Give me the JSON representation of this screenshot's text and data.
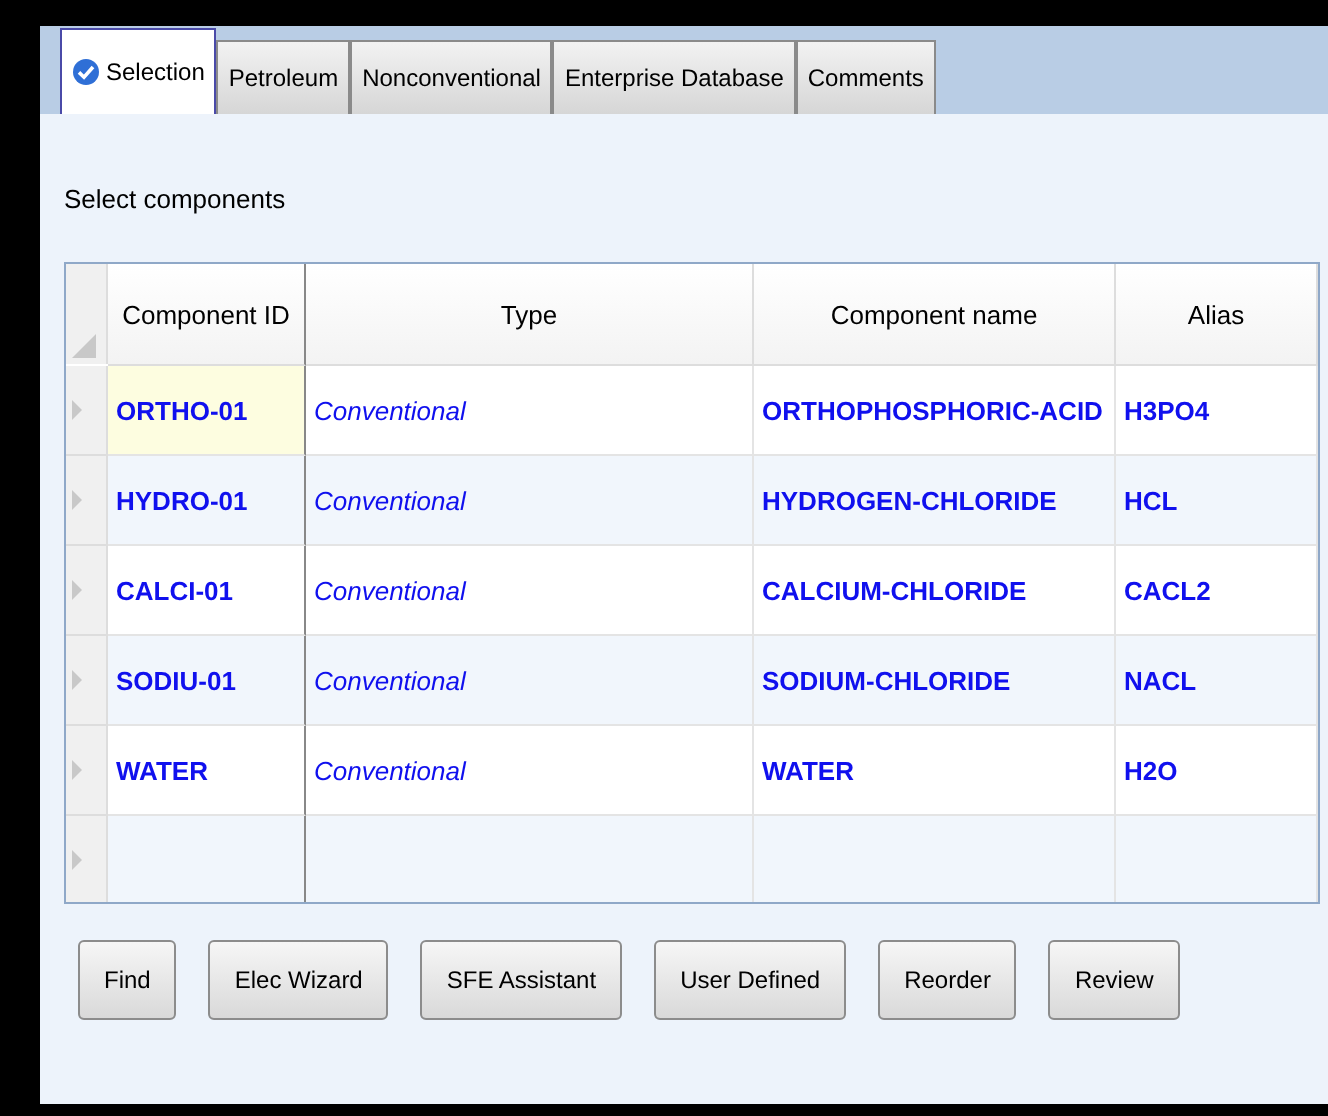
{
  "tabs": [
    {
      "label": "Selection",
      "selected": true
    },
    {
      "label": "Petroleum",
      "selected": false
    },
    {
      "label": "Nonconventional",
      "selected": false
    },
    {
      "label": "Enterprise Database",
      "selected": false
    },
    {
      "label": "Comments",
      "selected": false
    }
  ],
  "section_label": "Select components",
  "table": {
    "columns": [
      "Component ID",
      "Type",
      "Component name",
      "Alias"
    ],
    "rows": [
      {
        "cells": [
          "ORTHO-01",
          "Conventional",
          "ORTHOPHOSPHORIC-ACID",
          "H3PO4"
        ],
        "selected": true
      },
      {
        "cells": [
          "HYDRO-01",
          "Conventional",
          "HYDROGEN-CHLORIDE",
          "HCL"
        ],
        "selected": false
      },
      {
        "cells": [
          "CALCI-01",
          "Conventional",
          "CALCIUM-CHLORIDE",
          "CACL2"
        ],
        "selected": false
      },
      {
        "cells": [
          "SODIU-01",
          "Conventional",
          "SODIUM-CHLORIDE",
          "NACL"
        ],
        "selected": false
      },
      {
        "cells": [
          "WATER",
          "Conventional",
          "WATER",
          "H2O"
        ],
        "selected": false
      }
    ]
  },
  "buttons": [
    "Find",
    "Elec Wizard",
    "SFE Assistant",
    "User Defined",
    "Reorder",
    "Review"
  ]
}
